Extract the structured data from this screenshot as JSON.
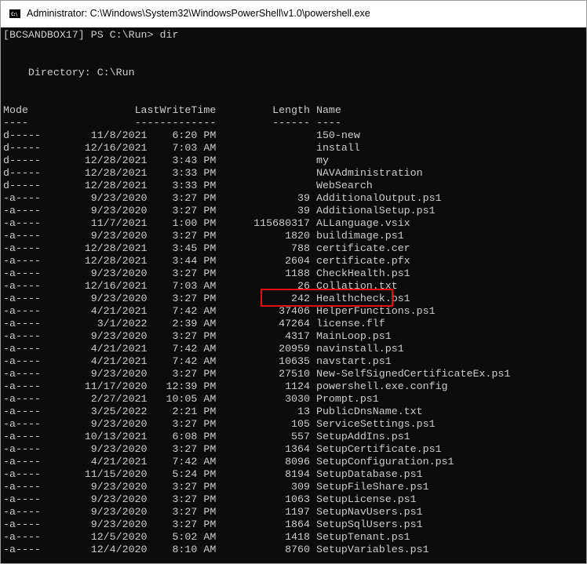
{
  "window": {
    "title": "Administrator: C:\\Windows\\System32\\WindowsPowerShell\\v1.0\\powershell.exe",
    "icon": "powershell-console-icon"
  },
  "console": {
    "prompt": "[BCSANDBOX17] PS C:\\Run> dir",
    "directory": "    Directory: C:\\Run",
    "header": "Mode                 LastWriteTime         Length Name",
    "underline": "----                 -------------         ------ ----",
    "rows": [
      {
        "mode": "d-----",
        "date": "11/8/2021",
        "time": "6:20 PM",
        "length": "",
        "name": "150-new"
      },
      {
        "mode": "d-----",
        "date": "12/16/2021",
        "time": "7:03 AM",
        "length": "",
        "name": "install"
      },
      {
        "mode": "d-----",
        "date": "12/28/2021",
        "time": "3:43 PM",
        "length": "",
        "name": "my"
      },
      {
        "mode": "d-----",
        "date": "12/28/2021",
        "time": "3:33 PM",
        "length": "",
        "name": "NAVAdministration"
      },
      {
        "mode": "d-----",
        "date": "12/28/2021",
        "time": "3:33 PM",
        "length": "",
        "name": "WebSearch"
      },
      {
        "mode": "-a----",
        "date": "9/23/2020",
        "time": "3:27 PM",
        "length": "39",
        "name": "AdditionalOutput.ps1"
      },
      {
        "mode": "-a----",
        "date": "9/23/2020",
        "time": "3:27 PM",
        "length": "39",
        "name": "AdditionalSetup.ps1"
      },
      {
        "mode": "-a----",
        "date": "11/7/2021",
        "time": "1:00 PM",
        "length": "115680317",
        "name": "ALLanguage.vsix"
      },
      {
        "mode": "-a----",
        "date": "9/23/2020",
        "time": "3:27 PM",
        "length": "1820",
        "name": "buildimage.ps1"
      },
      {
        "mode": "-a----",
        "date": "12/28/2021",
        "time": "3:45 PM",
        "length": "788",
        "name": "certificate.cer"
      },
      {
        "mode": "-a----",
        "date": "12/28/2021",
        "time": "3:44 PM",
        "length": "2604",
        "name": "certificate.pfx"
      },
      {
        "mode": "-a----",
        "date": "9/23/2020",
        "time": "3:27 PM",
        "length": "1188",
        "name": "CheckHealth.ps1"
      },
      {
        "mode": "-a----",
        "date": "12/16/2021",
        "time": "7:03 AM",
        "length": "26",
        "name": "Collation.txt"
      },
      {
        "mode": "-a----",
        "date": "9/23/2020",
        "time": "3:27 PM",
        "length": "242",
        "name": "Healthcheck.ps1"
      },
      {
        "mode": "-a----",
        "date": "4/21/2021",
        "time": "7:42 AM",
        "length": "37406",
        "name": "HelperFunctions.ps1"
      },
      {
        "mode": "-a----",
        "date": "3/1/2022",
        "time": "2:39 AM",
        "length": "47264",
        "name": "license.flf"
      },
      {
        "mode": "-a----",
        "date": "9/23/2020",
        "time": "3:27 PM",
        "length": "4317",
        "name": "MainLoop.ps1"
      },
      {
        "mode": "-a----",
        "date": "4/21/2021",
        "time": "7:42 AM",
        "length": "20959",
        "name": "navinstall.ps1"
      },
      {
        "mode": "-a----",
        "date": "4/21/2021",
        "time": "7:42 AM",
        "length": "10635",
        "name": "navstart.ps1"
      },
      {
        "mode": "-a----",
        "date": "9/23/2020",
        "time": "3:27 PM",
        "length": "27510",
        "name": "New-SelfSignedCertificateEx.ps1"
      },
      {
        "mode": "-a----",
        "date": "11/17/2020",
        "time": "12:39 PM",
        "length": "1124",
        "name": "powershell.exe.config"
      },
      {
        "mode": "-a----",
        "date": "2/27/2021",
        "time": "10:05 AM",
        "length": "3030",
        "name": "Prompt.ps1"
      },
      {
        "mode": "-a----",
        "date": "3/25/2022",
        "time": "2:21 PM",
        "length": "13",
        "name": "PublicDnsName.txt"
      },
      {
        "mode": "-a----",
        "date": "9/23/2020",
        "time": "3:27 PM",
        "length": "105",
        "name": "ServiceSettings.ps1"
      },
      {
        "mode": "-a----",
        "date": "10/13/2021",
        "time": "6:08 PM",
        "length": "557",
        "name": "SetupAddIns.ps1"
      },
      {
        "mode": "-a----",
        "date": "9/23/2020",
        "time": "3:27 PM",
        "length": "1364",
        "name": "SetupCertificate.ps1"
      },
      {
        "mode": "-a----",
        "date": "4/21/2021",
        "time": "7:42 AM",
        "length": "8096",
        "name": "SetupConfiguration.ps1"
      },
      {
        "mode": "-a----",
        "date": "11/15/2020",
        "time": "5:24 PM",
        "length": "8194",
        "name": "SetupDatabase.ps1"
      },
      {
        "mode": "-a----",
        "date": "9/23/2020",
        "time": "3:27 PM",
        "length": "309",
        "name": "SetupFileShare.ps1"
      },
      {
        "mode": "-a----",
        "date": "9/23/2020",
        "time": "3:27 PM",
        "length": "1063",
        "name": "SetupLicense.ps1"
      },
      {
        "mode": "-a----",
        "date": "9/23/2020",
        "time": "3:27 PM",
        "length": "1197",
        "name": "SetupNavUsers.ps1"
      },
      {
        "mode": "-a----",
        "date": "9/23/2020",
        "time": "3:27 PM",
        "length": "1864",
        "name": "SetupSqlUsers.ps1"
      },
      {
        "mode": "-a----",
        "date": "12/5/2020",
        "time": "5:02 AM",
        "length": "1418",
        "name": "SetupTenant.ps1"
      },
      {
        "mode": "-a----",
        "date": "12/4/2020",
        "time": "8:10 AM",
        "length": "8760",
        "name": "SetupVariables.ps1"
      }
    ]
  },
  "colors": {
    "console_bg": "#0c0c0c",
    "console_fg": "#cccccc",
    "highlight": "#e01010"
  }
}
